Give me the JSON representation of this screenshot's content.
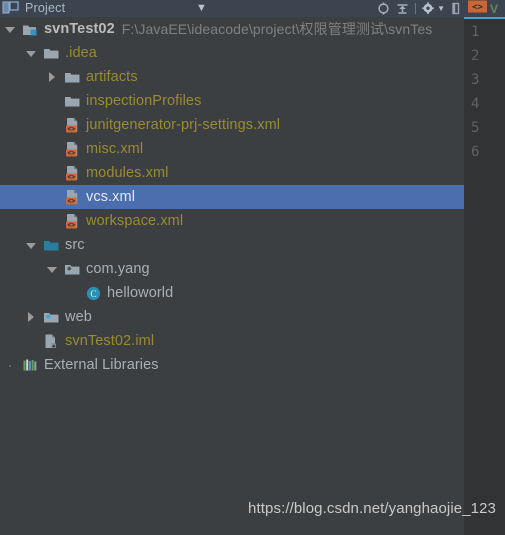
{
  "toolwindow": {
    "title": "Project",
    "chevron_icon": "chevron-down-icon",
    "tools": [
      {
        "name": "locate-target-icon",
        "label": "Select Opened File"
      },
      {
        "name": "collapse-all-icon",
        "label": "Collapse All"
      },
      {
        "name": "settings-gear-icon",
        "label": "Settings"
      },
      {
        "name": "hide-panel-icon",
        "label": "Hide"
      }
    ]
  },
  "editor": {
    "tab_icon": "xml-file-icon",
    "tab_label": "V",
    "line_numbers": [
      "1",
      "2",
      "3",
      "4",
      "5",
      "6"
    ]
  },
  "tree": {
    "nodes": [
      {
        "label": "svnTest02",
        "path": "F:\\JavaEE\\ideacode\\project\\权限管理测试\\svnTes",
        "icon": "module-icon",
        "twisty": "open",
        "indent": 0,
        "style": "root",
        "selected": false
      },
      {
        "label": ".idea",
        "icon": "folder-gray-icon",
        "twisty": "open",
        "indent": 1,
        "style": "yellow",
        "selected": false
      },
      {
        "label": "artifacts",
        "icon": "folder-gray-icon",
        "twisty": "closed",
        "indent": 2,
        "style": "yellow",
        "selected": false
      },
      {
        "label": "inspectionProfiles",
        "icon": "folder-gray-icon",
        "twisty": "none",
        "indent": 2,
        "style": "yellow",
        "selected": false
      },
      {
        "label": "junitgenerator-prj-settings.xml",
        "icon": "xml-file-icon",
        "twisty": "none",
        "indent": 2,
        "style": "yellow",
        "selected": false
      },
      {
        "label": "misc.xml",
        "icon": "xml-file-icon",
        "twisty": "none",
        "indent": 2,
        "style": "yellow",
        "selected": false
      },
      {
        "label": "modules.xml",
        "icon": "xml-file-icon",
        "twisty": "none",
        "indent": 2,
        "style": "yellow",
        "selected": false
      },
      {
        "label": "vcs.xml",
        "icon": "xml-file-icon",
        "twisty": "none",
        "indent": 2,
        "style": "white",
        "selected": true
      },
      {
        "label": "workspace.xml",
        "icon": "xml-file-icon",
        "twisty": "none",
        "indent": 2,
        "style": "yellow",
        "selected": false
      },
      {
        "label": "src",
        "icon": "folder-source-icon",
        "twisty": "open",
        "indent": 1,
        "style": "gray",
        "selected": false
      },
      {
        "label": "com.yang",
        "icon": "package-icon",
        "twisty": "open",
        "indent": 2,
        "style": "gray",
        "selected": false
      },
      {
        "label": "helloworld",
        "icon": "java-class-icon",
        "twisty": "none",
        "indent": 3,
        "style": "gray",
        "selected": false
      },
      {
        "label": "web",
        "icon": "folder-web-icon",
        "twisty": "closed",
        "indent": 1,
        "style": "gray",
        "selected": false
      },
      {
        "label": "svnTest02.iml",
        "icon": "iml-file-icon",
        "twisty": "none",
        "indent": 1,
        "style": "yellow",
        "selected": false
      },
      {
        "label": "External Libraries",
        "icon": "external-libraries-icon",
        "twisty": "dot",
        "indent": 0,
        "style": "gray",
        "selected": false
      }
    ]
  },
  "watermark": {
    "text": "https://blog.csdn.net/yanghaojie_123"
  },
  "colors": {
    "background": "#3c3f41",
    "header": "#3c4450",
    "selection": "#4b6eaf",
    "gutter": "#313335",
    "yellow_text": "#9a8b2e",
    "gray_text": "#a9b0b6",
    "xml_badge": "#cc6633",
    "source_folder": "#2a7d9e",
    "class_icon": "#2b8fb3"
  }
}
